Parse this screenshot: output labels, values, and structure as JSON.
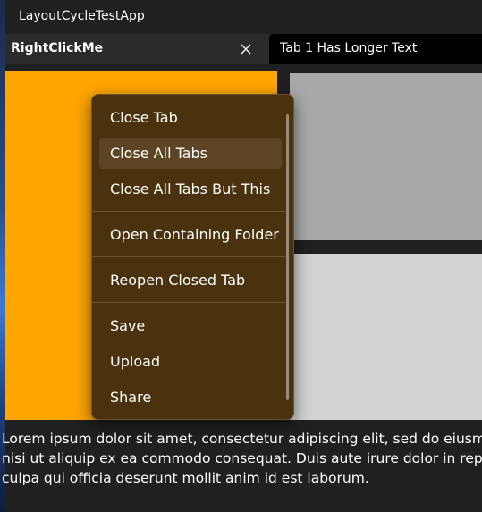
{
  "window": {
    "title": "LayoutCycleTestApp"
  },
  "tabs": [
    {
      "label": "RightClickMe",
      "active": true
    },
    {
      "label": "Tab 1 Has Longer Text",
      "active": false
    }
  ],
  "context_menu": {
    "items": [
      {
        "label": "Close Tab"
      },
      {
        "label": "Close All Tabs"
      },
      {
        "label": "Close All Tabs But This"
      },
      {
        "label": "Open Containing Folder"
      },
      {
        "label": "Reopen Closed Tab"
      },
      {
        "label": "Save"
      },
      {
        "label": "Upload"
      },
      {
        "label": "Share"
      }
    ]
  },
  "body_text": {
    "line1": "Lorem ipsum dolor sit amet, consectetur adipiscing elit, sed do eiusmod",
    "line2": "nisi ut aliquip ex ea commodo consequat. Duis aute irure dolor in repre",
    "line3": "culpa qui officia deserunt mollit anim id est laborum."
  },
  "colors": {
    "accent_panel": "#ffa500",
    "panel_gray_dark": "#a9a9a9",
    "panel_gray_light": "#d3d3d3",
    "menu_background": "#4a320f"
  },
  "icons": {
    "tab_close": "close-icon"
  }
}
